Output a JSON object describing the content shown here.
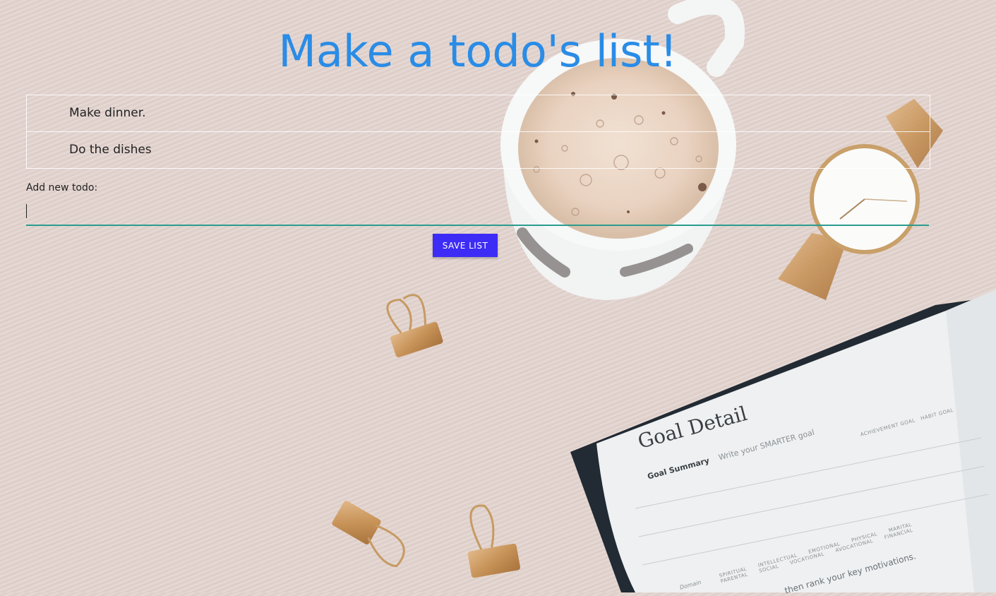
{
  "page": {
    "title": "Make a todo's list!"
  },
  "todos": [
    {
      "text": "Make dinner."
    },
    {
      "text": "Do the dishes"
    }
  ],
  "add_todo": {
    "label": "Add new todo:",
    "value": "",
    "placeholder": ""
  },
  "save_button": {
    "label": "SAVE LIST"
  },
  "notebook": {
    "heading": "Goal Detail",
    "summary_label": "Goal Summary",
    "summary_prompt": "Write your SMARTER goal",
    "goal_types": [
      "ACHIEVEMENT GOAL",
      "HABIT GOAL"
    ],
    "categories": [
      "SPIRITUAL",
      "PARENTAL",
      "INTELLECTUAL",
      "SOCIAL",
      "EMOTIONAL",
      "VOCATIONAL",
      "PHYSICAL",
      "AVOCATIONAL",
      "MARITAL",
      "FINANCIAL"
    ],
    "domain_label": "Domain",
    "footer_text": "then rank your key motivations."
  },
  "colors": {
    "title": "#2a8ce6",
    "button": "#3d2cf5",
    "input_underline": "#2a9d8f",
    "background": "#e3d5d0"
  }
}
